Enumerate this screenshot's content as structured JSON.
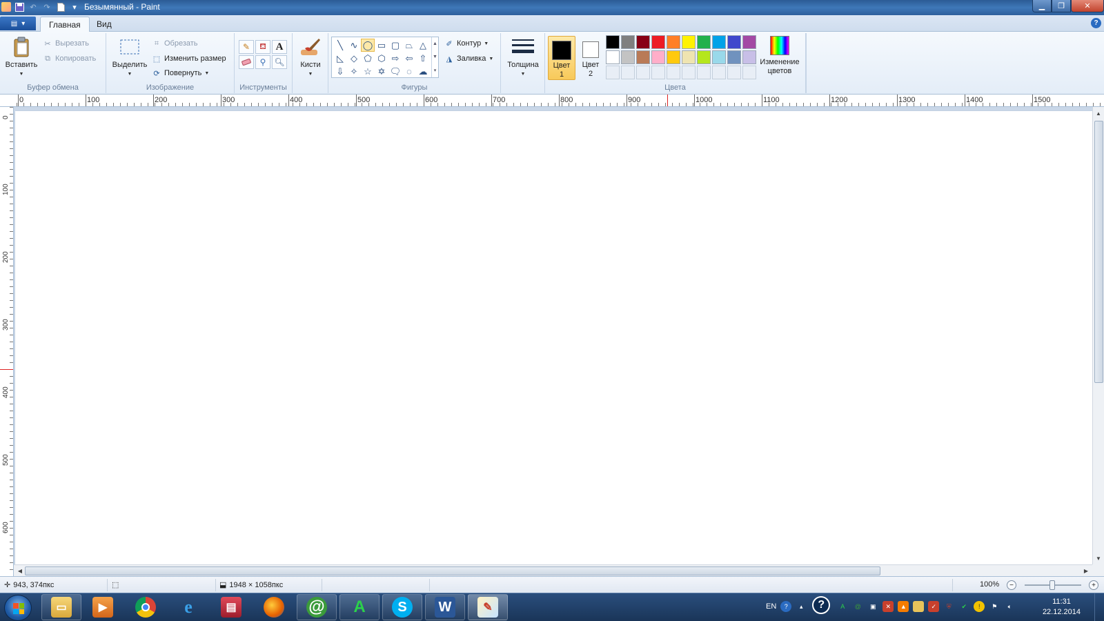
{
  "window": {
    "title": "Безымянный - Paint",
    "controls": [
      "minimize-icon",
      "maximize-icon",
      "close-icon"
    ]
  },
  "tabs": {
    "file_icon": "menu-icon",
    "items": [
      {
        "label": "Главная",
        "active": true
      },
      {
        "label": "Вид",
        "active": false
      }
    ]
  },
  "ribbon": {
    "clipboard": {
      "label": "Буфер обмена",
      "paste": "Вставить",
      "cut": "Вырезать",
      "copy": "Копировать"
    },
    "image": {
      "label": "Изображение",
      "select": "Выделить",
      "crop": "Обрезать",
      "resize": "Изменить размер",
      "rotate": "Повернуть"
    },
    "tools": {
      "label": "Инструменты",
      "items": [
        "pencil-icon",
        "fill-icon",
        "text-icon",
        "eraser-icon",
        "color-picker-icon",
        "magnifier-icon"
      ],
      "text_glyph": "A"
    },
    "brushes": {
      "label": "Кисти"
    },
    "shapes": {
      "label": "Фигуры",
      "outline": "Контур",
      "fill": "Заливка",
      "selected_index": 2
    },
    "size": {
      "label": "Толщина"
    },
    "colors": {
      "label": "Цвета",
      "color1_line1": "Цвет",
      "color1_line2": "1",
      "color2_line1": "Цвет",
      "color2_line2": "2",
      "color1_value": "#000000",
      "color2_value": "#ffffff",
      "edit_line1": "Изменение",
      "edit_line2": "цветов",
      "palette_row1": [
        "#000000",
        "#7f7f7f",
        "#880015",
        "#ed1c24",
        "#ff7f27",
        "#fff200",
        "#22b14c",
        "#00a2e8",
        "#3f48cc",
        "#a349a4"
      ],
      "palette_row2": [
        "#ffffff",
        "#c3c3c3",
        "#b97a57",
        "#ffaec9",
        "#ffc90e",
        "#efe4b0",
        "#b5e61d",
        "#99d9ea",
        "#7092be",
        "#c8bfe7"
      ],
      "palette_row3_empty": 10
    }
  },
  "rulers": {
    "horizontal": [
      "0",
      "100",
      "200",
      "300",
      "400",
      "500",
      "600",
      "700",
      "800",
      "900",
      "1000",
      "1100",
      "1200",
      "1300",
      "1400",
      "1500"
    ],
    "vertical": [
      "0",
      "100",
      "200",
      "300",
      "400",
      "500",
      "600"
    ]
  },
  "status": {
    "cursor_position": "943, 374пкс",
    "image_size": "1948 × 1058пкс",
    "zoom": "100%"
  },
  "taskbar": {
    "apps": [
      "explorer-icon",
      "media-player-icon",
      "chrome-icon",
      "internet-explorer-icon",
      "save-app-icon",
      "firefox-icon",
      "mail-agent-icon",
      "a-app-icon",
      "skype-icon",
      "word-icon",
      "paint-icon"
    ],
    "lang": "EN",
    "time": "11:31",
    "date": "22.12.2014"
  }
}
